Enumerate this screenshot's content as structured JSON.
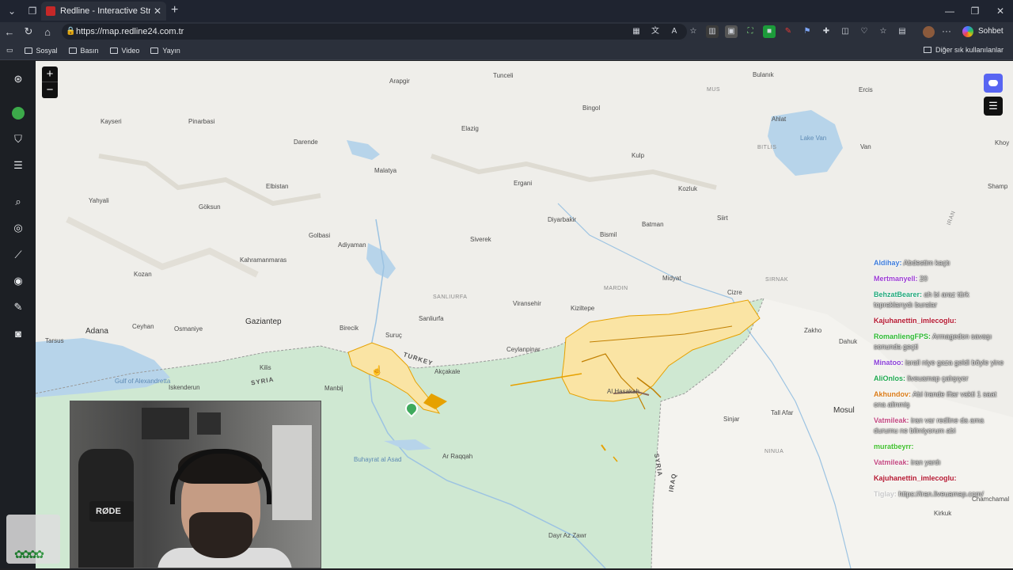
{
  "browser": {
    "tab_title": "Redline - Interactive Strategic Map",
    "url": "https://map.redline24.com.tr",
    "copilot_label": "Sohbet et",
    "bookmarks": [
      "Sosyal",
      "Basın",
      "Video",
      "Yayın"
    ],
    "other_bookmarks": "Diğer sık kullanılanlar"
  },
  "map": {
    "zoom_in": "+",
    "zoom_out": "−",
    "places": {
      "arapgir": "Arapgir",
      "tunceli": "Tunceli",
      "bingol": "Bingol",
      "bulanik": "Bulanık",
      "mus": "MUS",
      "kayseri": "Kayseri",
      "pinarbasi": "Pinarbasi",
      "darende": "Darende",
      "elazig": "Elazig",
      "ahlat": "Ahlat",
      "ercis": "Ercis",
      "malatya": "Malatya",
      "elbistan": "Elbistan",
      "ergani": "Ergani",
      "kulp": "Kulp",
      "lakevan": "Lake Van",
      "van": "Van",
      "bitlis": "BITLIS",
      "diyarbakir": "Diyarbakir",
      "kozluk": "Kozluk",
      "batman": "Batman",
      "siirt": "Siirt",
      "bismil": "Bismil",
      "goksun": "Göksun",
      "yahyali": "Yahyali",
      "adiyaman": "Adiyaman",
      "golbasi": "Golbasi",
      "kahramanmaras": "Kahramanmaras",
      "siverek": "Siverek",
      "kozan": "Kozan",
      "midyat": "Midyat",
      "mardin": "MARDIN",
      "sanliurfa_cap": "SANLIURFA",
      "sanliurfa": "Sanliurfa",
      "viransehir": "Viransehir",
      "kiziltepe": "Kiziltepe",
      "cizre": "Cizre",
      "adana": "Adana",
      "gaziantep": "Gaziantep",
      "ceyhan": "Ceyhan",
      "osmaniye": "Osmaniye",
      "birecik": "Birecik",
      "suruc": "Suruç",
      "ceylanpinar": "Ceylanpinar",
      "turkey": "TURKEY",
      "akcakale": "Akçakale",
      "tarsus": "Tarsus",
      "kilis": "Kilis",
      "syria": "SYRIA",
      "manbij": "Manbij",
      "gulf": "Gulf of Alexandretta",
      "iskenderun": "Iskenderun",
      "zakho": "Zakho",
      "dahuk": "Dahuk",
      "hasakah": "Al Hasakah",
      "sinjar": "Sinjar",
      "talafar": "Tall Afar",
      "mosul": "Mosul",
      "raqqah": "Ar Raqqah",
      "ninua": "NINUA",
      "syria2": "SYRIA",
      "iraq": "IRAQ",
      "buhayrat": "Buhayrat al Asad",
      "dayr": "Dayr Az Zawr",
      "chamchamal": "Chamchamal",
      "kirkuk": "Kirkuk",
      "iran": "IRAN",
      "sirnak": "SIRNAK",
      "hakkari": "Shamp",
      "khoy": "Khoy"
    }
  },
  "chat": [
    {
      "user": "Aldihay:",
      "text": "Abdestim kaçtı",
      "color": "#3d7bd9"
    },
    {
      "user": "Mertmanyell:",
      "text": "20",
      "color": "#9b3ad1"
    },
    {
      "user": "BehzatBearer:",
      "text": "ah bi araz türk topraklarıydı buralar",
      "color": "#1fa87a"
    },
    {
      "user": "Kajuhanettin_imlecoglu:",
      "text": "",
      "color": "#b3162d"
    },
    {
      "user": "RomanliengFPS:",
      "text": "Armagedon savaşı sonunda geçti",
      "color": "#2cb830"
    },
    {
      "user": "Minatoo:",
      "text": "israil niye gaza geldi böyle yine",
      "color": "#8a3fd6"
    },
    {
      "user": "AliOnlos:",
      "text": "liveuamap çalışıyor",
      "color": "#1fa84e"
    },
    {
      "user": "Akhundov:",
      "text": "Abi irande iftar vakti 1 saat ona alinmiş",
      "color": "#d97a16"
    },
    {
      "user": "Vatmileak:",
      "text": "iran var redline da ama durumu ne bilmiyorum abi",
      "color": "#c2477f"
    },
    {
      "user": "muratbeyrr:",
      "text": "",
      "color": "#3fbe2a"
    },
    {
      "user": "Vatmileak:",
      "text": "iran yardı",
      "color": "#c2477f"
    },
    {
      "user": "Kajuhanettin_imlecoglu:",
      "text": "",
      "color": "#b3162d"
    },
    {
      "user": "Tiglay:",
      "text": "https://iran.liveuamap.com/",
      "color": "#c9c9c9"
    }
  ],
  "webcam": {
    "mic_brand": "RØDE"
  }
}
